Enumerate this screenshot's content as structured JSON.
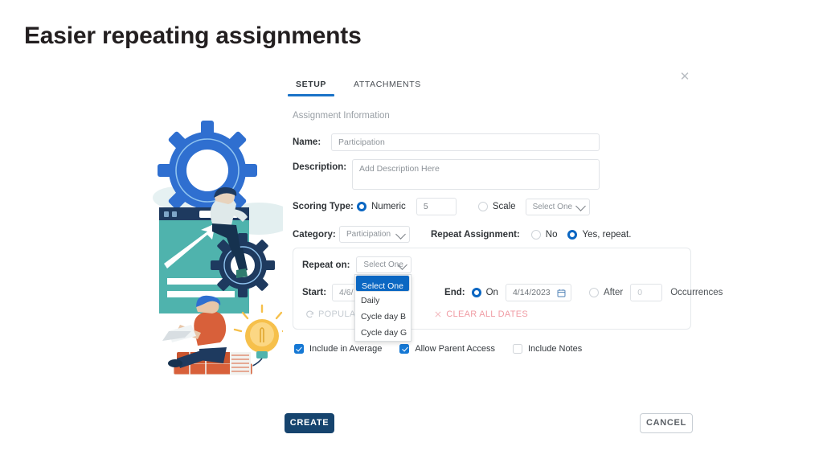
{
  "slide": {
    "title": "Easier repeating assignments"
  },
  "dialog": {
    "close_icon": "close-icon",
    "tabs": [
      {
        "label": "SETUP",
        "active": true
      },
      {
        "label": "ATTACHMENTS",
        "active": false
      }
    ],
    "section_label": "Assignment Information",
    "fields": {
      "name_label": "Name:",
      "name_value": "Participation",
      "description_label": "Description:",
      "description_value": "Add Description Here",
      "scoring_type_label": "Scoring Type:",
      "scoring_numeric_label": "Numeric",
      "scoring_numeric_value": "5",
      "scoring_scale_label": "Scale",
      "scoring_scale_select": "Select One",
      "category_label": "Category:",
      "category_value": "Participation",
      "repeat_assignment_label": "Repeat Assignment:",
      "repeat_no_label": "No",
      "repeat_yes_label": "Yes, repeat."
    },
    "repeat_panel": {
      "repeat_on_label": "Repeat on:",
      "repeat_on_value": "Select One",
      "dropdown_open": true,
      "dropdown_options": [
        {
          "label": "Select One",
          "selected": true
        },
        {
          "label": "Daily",
          "selected": false
        },
        {
          "label": "Cycle day B",
          "selected": false
        },
        {
          "label": "Cycle day G",
          "selected": false
        }
      ],
      "start_label": "Start:",
      "start_value": "4/6/",
      "end_label": "End:",
      "end_on_label": "On",
      "end_on_value": "4/14/2023",
      "calendar_icon": "calendar-icon",
      "end_after_label": "After",
      "end_after_value": "0",
      "occurrences_label": "Occurrences",
      "populate_label": "POPULATE",
      "populate_icon": "refresh-icon",
      "clear_all_label": "CLEAR ALL DATES",
      "clear_all_icon": "close-small-icon"
    },
    "checkboxes": [
      {
        "label": "Include in Average",
        "checked": true
      },
      {
        "label": "Allow Parent Access",
        "checked": true
      },
      {
        "label": "Include Notes",
        "checked": false
      }
    ],
    "buttons": {
      "create": "CREATE",
      "cancel": "CANCEL"
    }
  },
  "colors": {
    "accent_blue": "#0a66c2",
    "tab_underline": "#1a73c8",
    "dropdown_highlight": "#0b67c2",
    "create_button": "#16446e",
    "clear_link": "#f09ca4",
    "checkbox_blue": "#1578d4"
  }
}
